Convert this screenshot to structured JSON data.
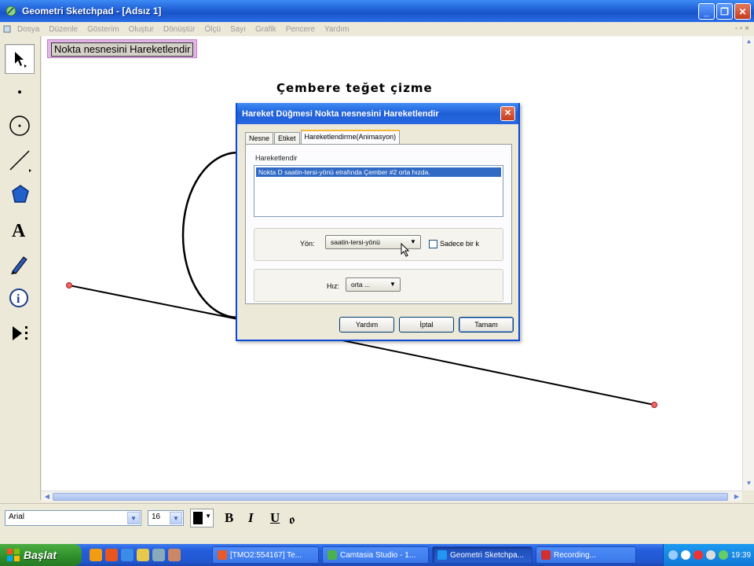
{
  "window": {
    "title": "Geometri Sketchpad - [Adsız 1]",
    "buttons": {
      "minimize": "_",
      "restore": "❐",
      "close": "✕"
    }
  },
  "menu": [
    "Dosya",
    "Düzenle",
    "Gösterim",
    "Oluştur",
    "Dönüştür",
    "Ölçü",
    "Sayı",
    "Grafik",
    "Pencere",
    "Yardım"
  ],
  "menu_right": "- ▫ ×",
  "canvas": {
    "action_button": "Nokta nesnesini Hareketlendir",
    "heading": "Çembere teğet çizme"
  },
  "dialog": {
    "title": "Hareket Düğmesi Nokta nesnesini Hareketlendir",
    "tabs": [
      {
        "label": "Nesne",
        "active": false
      },
      {
        "label": "Etiket",
        "active": false
      },
      {
        "label": "Hareketlendirme(Animasyon)",
        "active": true
      }
    ],
    "list_label": "Hareketlendir",
    "list_items": [
      "Nokta D saatin-tersi-yönü etrafında Çember #2 orta hızda."
    ],
    "direction_label": "Yön:",
    "direction_value": "saatin-tersi-yönü",
    "once_label": "Sadece bir k",
    "speed_label": "Hız:",
    "speed_value": "orta ...",
    "buttons": {
      "help": "Yardım",
      "cancel": "İptal",
      "ok": "Tamam"
    }
  },
  "format_bar": {
    "font": "Arial",
    "size": "16",
    "bold": "B",
    "italic": "I",
    "underline": "U",
    "symbol": "ꬽ"
  },
  "taskbar": {
    "start": "Başlat",
    "tasks": [
      {
        "label": "[TMO2:554167] Te...",
        "active": false,
        "color": "#e85a2a"
      },
      {
        "label": "Camtasia Studio - 1...",
        "active": false,
        "color": "#4caf50"
      },
      {
        "label": "Geometri Sketchpa...",
        "active": true,
        "color": "#2196f3"
      },
      {
        "label": "Recording...",
        "active": false,
        "color": "#d32f2f"
      }
    ],
    "clock": "19:39"
  },
  "colors": {
    "accent": "#1f5fd6",
    "selection": "#316ac5",
    "point": "#c0392b",
    "action_highlight": "#e4b6e8"
  }
}
